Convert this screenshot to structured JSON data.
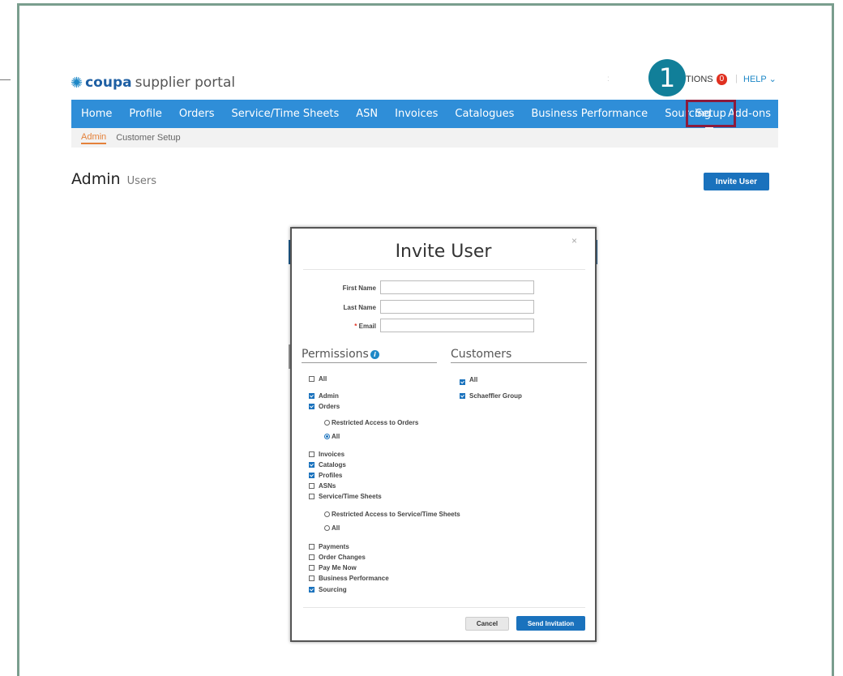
{
  "header": {
    "logo_brand": "coupa",
    "logo_product": "supplier portal",
    "step_number": "1",
    "notifications_label": "TIONS",
    "notifications_count": "0",
    "help_label": "HELP ⌄"
  },
  "nav": {
    "items": [
      "Home",
      "Profile",
      "Orders",
      "Service/Time Sheets",
      "ASN",
      "Invoices",
      "Catalogues",
      "Business Performance",
      "Sourcing",
      "Add-ons"
    ],
    "setup": "Setup"
  },
  "subnav": {
    "admin": "Admin",
    "customer_setup": "Customer Setup"
  },
  "page": {
    "title": "Admin",
    "subtitle": "Users",
    "invite_button": "Invite User"
  },
  "modal": {
    "title": "Invite User",
    "close": "×",
    "first_name_label": "First Name",
    "last_name_label": "Last Name",
    "email_required_mark": "*",
    "email_label": "Email",
    "permissions_heading": "Permissions",
    "customers_heading": "Customers",
    "permissions": {
      "all": {
        "label": "All",
        "checked": false
      },
      "admin": {
        "label": "Admin",
        "checked": true
      },
      "orders": {
        "label": "Orders",
        "checked": true
      },
      "orders_restricted": {
        "label": "Restricted Access to Orders",
        "selected": false
      },
      "orders_all": {
        "label": "All",
        "selected": true
      },
      "invoices": {
        "label": "Invoices",
        "checked": false
      },
      "catalogs": {
        "label": "Catalogs",
        "checked": true
      },
      "profiles": {
        "label": "Profiles",
        "checked": true
      },
      "asns": {
        "label": "ASNs",
        "checked": false
      },
      "service_time_sheets": {
        "label": "Service/Time Sheets",
        "checked": false
      },
      "sts_restricted": {
        "label": "Restricted Access to Service/Time Sheets",
        "selected": false
      },
      "sts_all": {
        "label": "All",
        "selected": false
      },
      "payments": {
        "label": "Payments",
        "checked": false
      },
      "order_changes": {
        "label": "Order Changes",
        "checked": false
      },
      "pay_me_now": {
        "label": "Pay Me Now",
        "checked": false
      },
      "business_performance": {
        "label": "Business Performance",
        "checked": false
      },
      "sourcing": {
        "label": "Sourcing",
        "checked": true
      }
    },
    "customers": {
      "all": {
        "label": "All",
        "checked": true
      },
      "schaeffler": {
        "label": "Schaeffler Group",
        "checked": true
      }
    },
    "cancel_button": "Cancel",
    "send_button": "Send Invitation"
  },
  "colors": {
    "nav_bar": "#2f8ed8",
    "setup_highlight": "#8c1b3c",
    "step_badge": "#117f99",
    "primary_button": "#1a72bd",
    "active_tab": "#e4813a"
  }
}
